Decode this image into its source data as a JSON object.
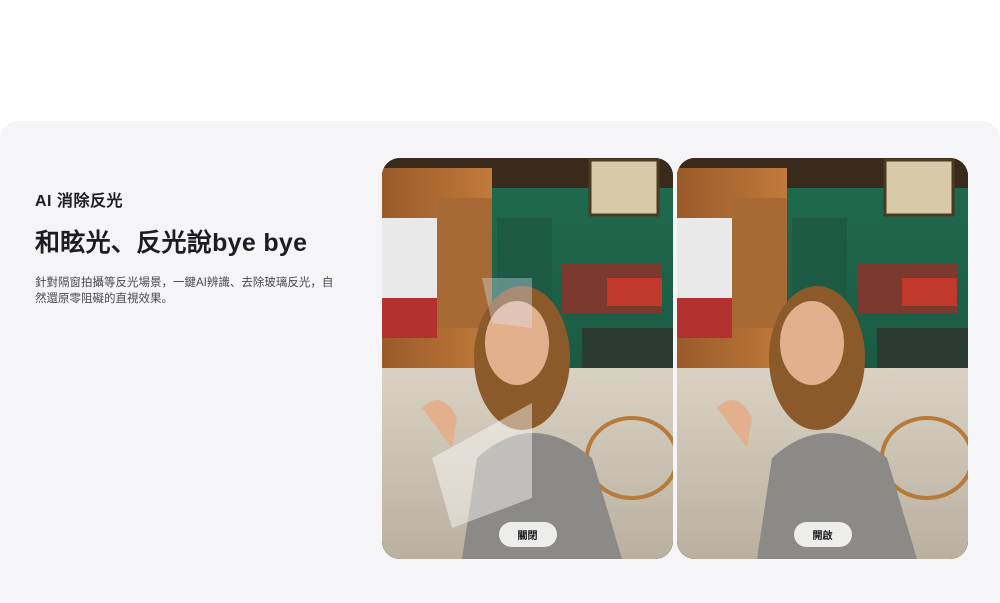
{
  "feature": {
    "eyebrow": "AI 消除反光",
    "headline": "和眩光、反光說bye bye",
    "description": "針對隔窗拍攝等反光場景，一鍵AI辨識、去除玻璃反光，自然還原零阻礙的直視效果。"
  },
  "comparison": {
    "off_label": "關閉",
    "on_label": "開啟"
  }
}
